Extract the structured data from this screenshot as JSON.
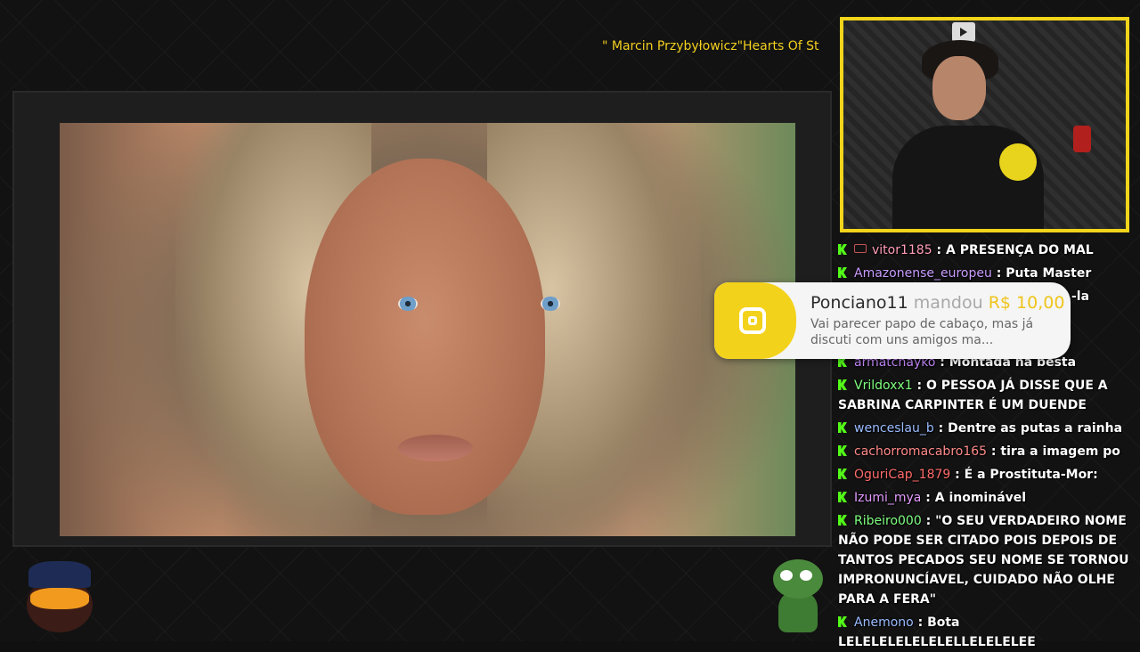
{
  "now_playing": "\" Marcin Przybyłowicz\"Hearts Of St",
  "colors": {
    "accent": "#f2d41b",
    "kick_green": "#53fc18",
    "background": "#121212"
  },
  "donation": {
    "username": "Ponciano11",
    "verb": "mandou",
    "amount": "R$ 10,00",
    "message": "Vai parecer papo de cabaço, mas já discuti com uns amigos ma..."
  },
  "chat": [
    {
      "user": "vitor1185",
      "color": "#ff9db8",
      "text": "A PRESENÇA DO MAL",
      "badge": true
    },
    {
      "user": "Amazonense_europeu",
      "color": "#c99cff",
      "text": "Puta Master"
    },
    {
      "user": "",
      "color": "#ffffff",
      "text": "-la",
      "partial": true
    },
    {
      "user": "armatchayko",
      "color": "#c88cff",
      "text": "Montada na besta"
    },
    {
      "user": "Vrildoxx1",
      "color": "#7fff7f",
      "text": "O PESSOA JÁ DISSE QUE A SABRINA CARPINTER É UM DUENDE"
    },
    {
      "user": "wenceslau_b",
      "color": "#9bbcff",
      "text": "Dentre as putas a rainha"
    },
    {
      "user": "cachorromacabro165",
      "color": "#ff8a8a",
      "text": "tira a imagem po"
    },
    {
      "user": "OguriCap_1879",
      "color": "#ff6b6b",
      "text": "É a Prostituta-Mor:"
    },
    {
      "user": "Izumi_mya",
      "color": "#e49cff",
      "text": "A inominável"
    },
    {
      "user": "Ribeiro000",
      "color": "#7fff7f",
      "text": "\"O SEU VERDADEIRO NOME NÃO PODE SER CITADO POIS DEPOIS DE TANTOS PECADOS SEU NOME SE TORNOU IMPRONUNCÍAVEL, CUIDADO NÃO OLHE PARA A FERA\""
    },
    {
      "user": "Anemono",
      "color": "#9bbcff",
      "text": "Bota LELELELELELELELLELELELEE"
    }
  ]
}
